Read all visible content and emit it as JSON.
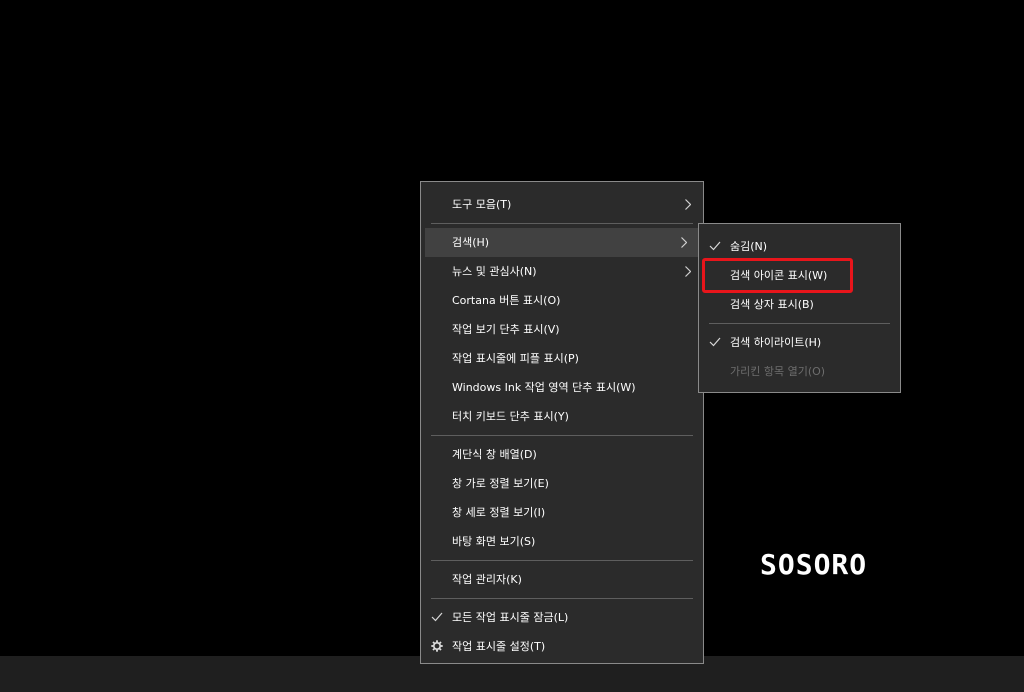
{
  "main_menu": {
    "toolbars": "도구 모음(T)",
    "search": "검색(H)",
    "news": "뉴스 및 관심사(N)",
    "cortana": "Cortana 버튼 표시(O)",
    "task_view": "작업 보기 단추 표시(V)",
    "people": "작업 표시줄에 피플 표시(P)",
    "ink": "Windows Ink 작업 영역 단추 표시(W)",
    "touch_keyboard": "터치 키보드 단추 표시(Y)",
    "cascade": "계단식 창 배열(D)",
    "stacked": "창 가로 정렬 보기(E)",
    "side_by_side": "창 세로 정렬 보기(I)",
    "show_desktop": "바탕 화면 보기(S)",
    "task_manager": "작업 관리자(K)",
    "lock_taskbars": "모든 작업 표시줄 잠금(L)",
    "taskbar_settings": "작업 표시줄 설정(T)"
  },
  "sub_menu": {
    "hidden": "숨김(N)",
    "show_icon": "검색 아이콘 표시(W)",
    "show_box": "검색 상자 표시(B)",
    "highlights": "검색 하이라이트(H)",
    "open_hidden": "가리킨 항목 열기(O)"
  },
  "watermark": "SOSORO",
  "colors": {
    "menu_bg": "#2b2b2b",
    "hover_bg": "#414141",
    "highlight_border": "#e8151b",
    "disabled_text": "#6d6d6d"
  }
}
